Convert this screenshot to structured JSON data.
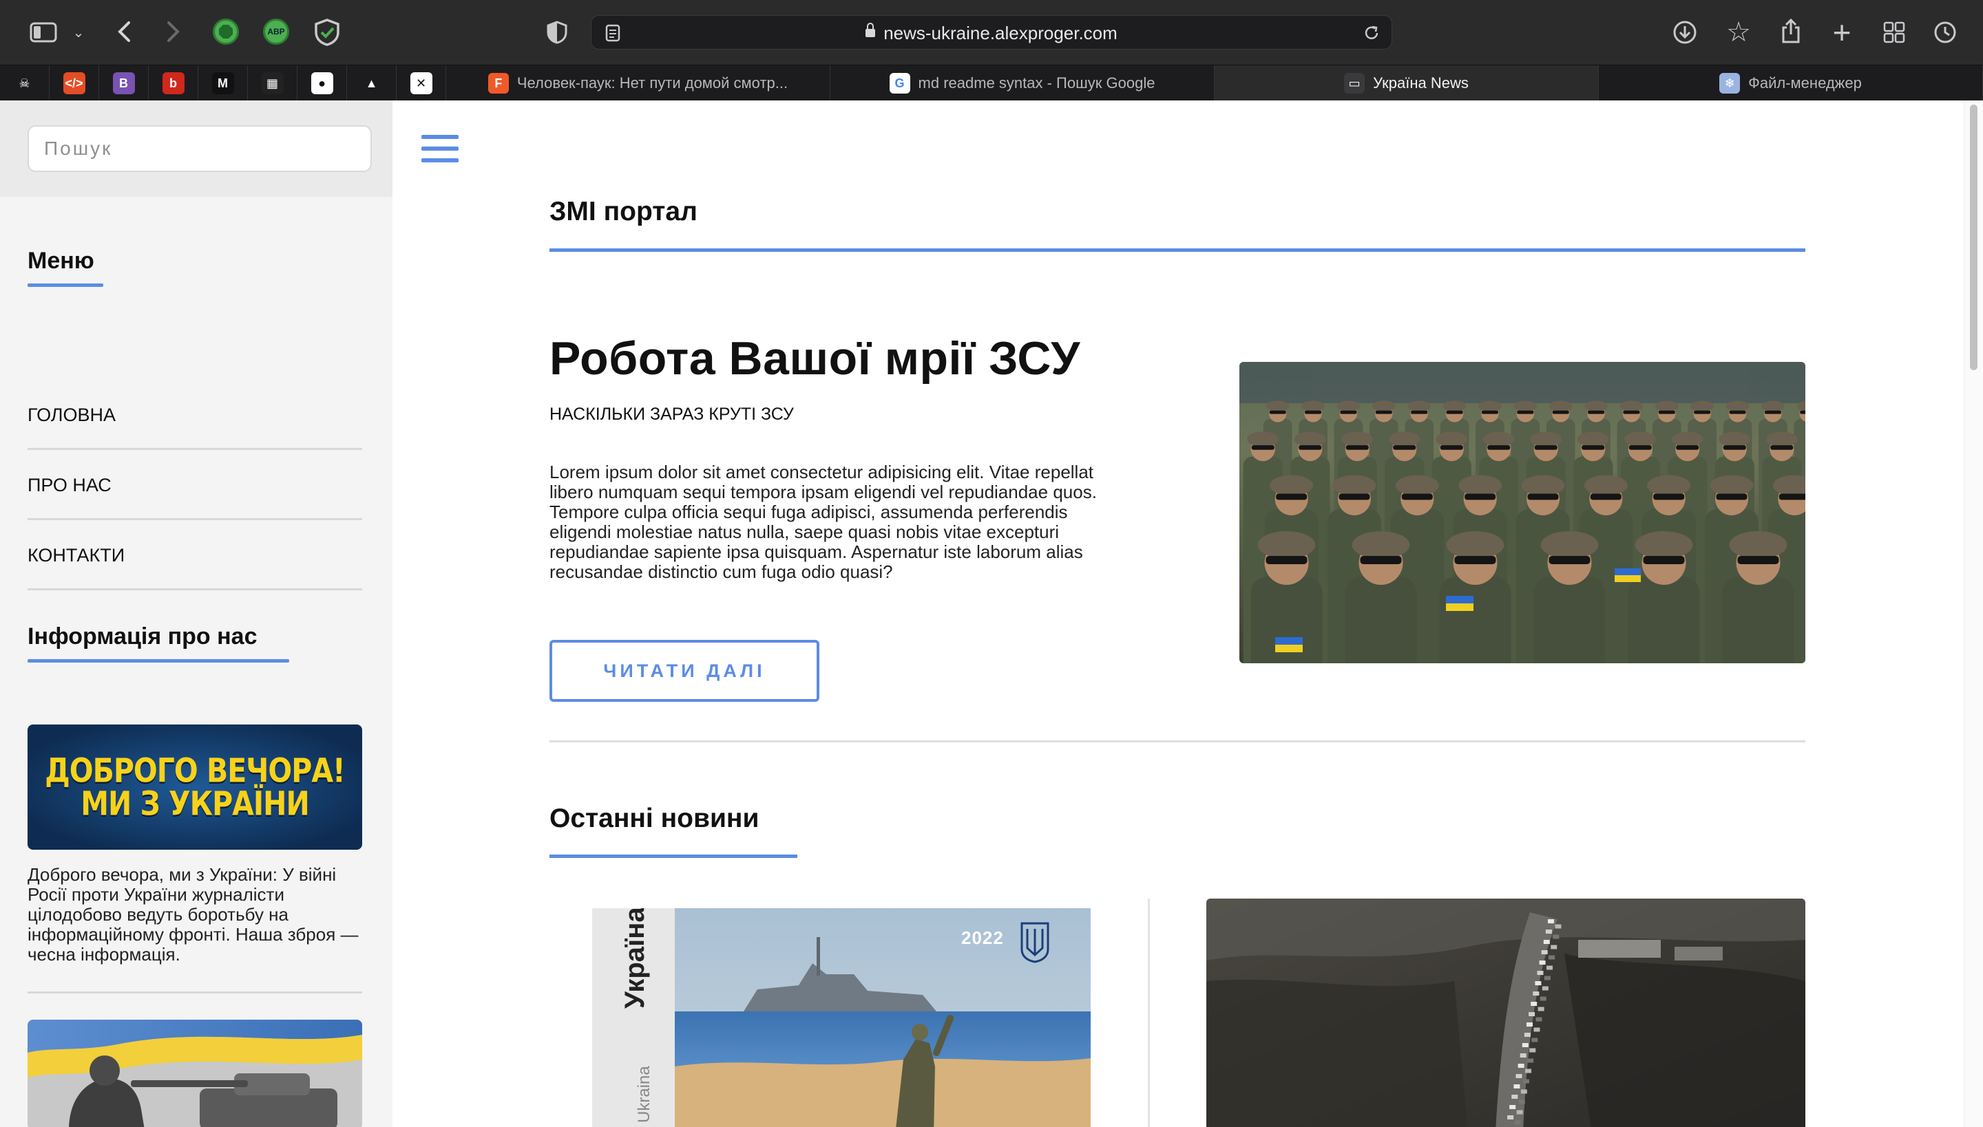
{
  "browser": {
    "url": "news-ukraine.alexproger.com",
    "pinned_tabs": [
      {
        "icon": "skull-icon",
        "glyph": "☠",
        "bg": "#1c1c1e"
      },
      {
        "icon": "code-editor-icon",
        "glyph": "</>",
        "bg": "#e44d26"
      },
      {
        "icon": "bootstrap-icon",
        "glyph": "B",
        "bg": "#7952b3"
      },
      {
        "icon": "red-app-icon",
        "glyph": "b",
        "bg": "#d0281c"
      },
      {
        "icon": "m-app-icon",
        "glyph": "M",
        "bg": "#111111"
      },
      {
        "icon": "clapper-icon",
        "glyph": "▦",
        "bg": "#222222"
      },
      {
        "icon": "github-icon",
        "glyph": "●",
        "bg": "#ffffff"
      },
      {
        "icon": "mountains-icon",
        "glyph": "▲",
        "bg": "#1c1c1e"
      },
      {
        "icon": "x-square-icon",
        "glyph": "✕",
        "bg": "#ffffff"
      }
    ],
    "tabs": [
      {
        "title": "Человек-паук: Нет пути домой смотр...",
        "icon": "f-icon",
        "glyph": "F",
        "color": "#f05a28",
        "active": false
      },
      {
        "title": "md readme syntax - Пошук Google",
        "icon": "google-icon",
        "glyph": "G",
        "color": "#ffffff",
        "active": false
      },
      {
        "title": "Україна News",
        "icon": "monitor-icon",
        "glyph": "▭",
        "color": "#3a3a3c",
        "active": true
      },
      {
        "title": "Файл-менеджер",
        "icon": "file-manager-icon",
        "glyph": "❄",
        "color": "#9ab4e0",
        "active": false
      }
    ],
    "extensions": {
      "abp": "ABP"
    }
  },
  "sidebar": {
    "search_placeholder": "Пошук",
    "menu_title": "Меню",
    "menu_items": [
      "ГОЛОВНА",
      "ПРО НАС",
      "КОНТАКТИ"
    ],
    "info_title": "Інформація про нас",
    "banner_lines": [
      "ДОБРОГО ВЕЧОРА!",
      "МИ З УКРАЇНИ"
    ],
    "info_text": "Доброго вечора, ми з України: У війні Росії проти України журналісти цілодобово ведуть боротьбу на інформаційному фронті. Наша зброя — чесна інформація."
  },
  "main": {
    "portal_title": "ЗМІ портал",
    "article": {
      "title": "Робота Вашої мрії ЗСУ",
      "subtitle": "НАСКІЛЬКИ ЗАРАЗ КРУТІ ЗСУ",
      "body": "Lorem ipsum dolor sit amet consectetur adipisicing elit. Vitae repellat libero numquam sequi tempora ipsam eligendi vel repudiandae quos. Tempore culpa officia sequi fuga adipisci, assumenda perferendis eligendi molestiae natus nulla, saepe quasi nobis vitae excepturi repudiandae sapiente ipsa quisquam. Aspernatur iste laborum alias recusandae distinctio cum fuga odio quasi?",
      "button": "ЧИТАТИ ДАЛІ"
    },
    "latest_title": "Останні новини",
    "stamp": {
      "year": "2022",
      "country": "Україна",
      "country_latin": "Ukraina"
    }
  },
  "colors": {
    "accent": "#5b8ce6",
    "chrome": "#2b2b2c",
    "sidebar": "#f4f4f4"
  }
}
